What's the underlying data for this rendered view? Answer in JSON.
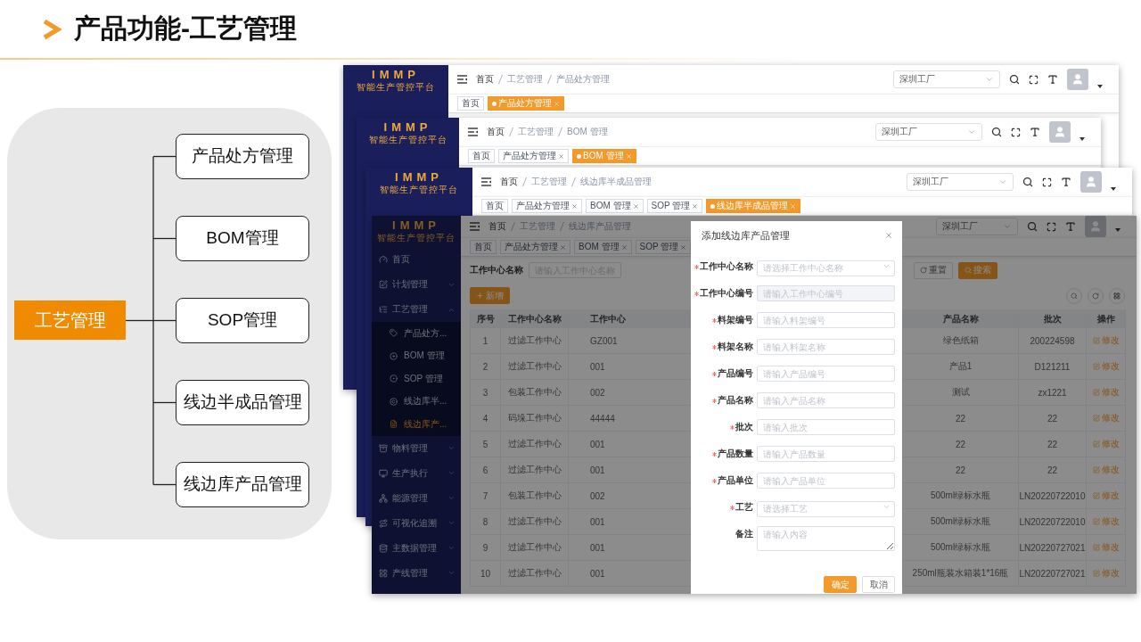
{
  "header": {
    "title": "产品功能-工艺管理"
  },
  "diagram": {
    "root": "工艺管理",
    "branches": [
      "产品处方管理",
      "BOM管理",
      "SOP管理",
      "线边半成品管理",
      "线边库产品管理"
    ]
  },
  "back_screens": [
    {
      "logo": "IMMP",
      "platform": "智能生产管控平台",
      "breadcrumb": [
        "首页",
        "工艺管理",
        "产品处方管理"
      ],
      "factory": "深圳工厂",
      "tags": [
        {
          "label": "首页",
          "selected": false,
          "closable": false
        },
        {
          "label": "产品处方管理",
          "selected": true,
          "closable": true
        }
      ]
    },
    {
      "logo": "IMMP",
      "platform": "智能生产管控平台",
      "breadcrumb": [
        "首页",
        "工艺管理",
        "BOM 管理"
      ],
      "factory": "深圳工厂",
      "tags": [
        {
          "label": "首页",
          "selected": false,
          "closable": false
        },
        {
          "label": "产品处方管理",
          "selected": false,
          "closable": true
        },
        {
          "label": "BOM 管理",
          "selected": true,
          "closable": true
        }
      ]
    },
    {
      "logo": "IMMP",
      "platform": "智能生产管控平台",
      "breadcrumb": [
        "首页",
        "工艺管理",
        "线边库半成品管理"
      ],
      "factory": "深圳工厂",
      "tags": [
        {
          "label": "首页",
          "selected": false,
          "closable": false
        },
        {
          "label": "产品处方管理",
          "selected": false,
          "closable": true
        },
        {
          "label": "BOM 管理",
          "selected": false,
          "closable": true
        },
        {
          "label": "SOP 管理",
          "selected": false,
          "closable": true
        },
        {
          "label": "线边库半成品管理",
          "selected": true,
          "closable": true
        }
      ]
    }
  ],
  "front_screen": {
    "logo": "IMMP",
    "platform": "智能生产管控平台",
    "breadcrumb": [
      "首页",
      "工艺管理",
      "线边库产品管理"
    ],
    "factory": "深圳工厂",
    "tags": [
      {
        "label": "首页",
        "selected": false,
        "closable": false
      },
      {
        "label": "产品处方管理",
        "selected": false,
        "closable": true
      },
      {
        "label": "BOM 管理",
        "selected": false,
        "closable": true
      },
      {
        "label": "SOP 管理",
        "selected": false,
        "closable": true
      }
    ],
    "sidebar": [
      {
        "label": "首页"
      },
      {
        "label": "计划管理",
        "expanded": false
      },
      {
        "label": "工艺管理",
        "expanded": true,
        "children": [
          {
            "label": "产品处方...",
            "selected": false
          },
          {
            "label": "BOM 管理",
            "selected": false
          },
          {
            "label": "SOP 管理",
            "selected": false
          },
          {
            "label": "线边库半...",
            "selected": false
          },
          {
            "label": "线边库产...",
            "selected": true
          }
        ]
      },
      {
        "label": "物料管理",
        "expanded": false
      },
      {
        "label": "生产执行",
        "expanded": false
      },
      {
        "label": "能源管理",
        "expanded": false
      },
      {
        "label": "可视化追溯",
        "expanded": false
      },
      {
        "label": "主数据管理",
        "expanded": false
      },
      {
        "label": "产线管理",
        "expanded": false
      }
    ],
    "filter": {
      "label": "工作中心名称",
      "placeholder": "请输入工作中心名称",
      "reset": "重置",
      "search": "搜索"
    },
    "add_button": "新增",
    "table": {
      "columns": [
        "序号",
        "工作中心名称",
        "工作中心",
        "产品名称",
        "批次",
        "操作"
      ],
      "rows": [
        [
          "1",
          "过滤工作中心",
          "GZ001",
          "绿色纸箱",
          "200224598",
          "修改"
        ],
        [
          "2",
          "过滤工作中心",
          "001",
          "产品1",
          "D121211",
          "修改"
        ],
        [
          "3",
          "包装工作中心",
          "002",
          "测试",
          "zx1221",
          "修改"
        ],
        [
          "4",
          "码垛工作中心",
          "44444",
          "22",
          "22",
          "修改"
        ],
        [
          "5",
          "过滤工作中心",
          "001",
          "22",
          "22",
          "修改"
        ],
        [
          "6",
          "过滤工作中心",
          "001",
          "22",
          "22",
          "修改"
        ],
        [
          "7",
          "包装工作中心",
          "002",
          "500ml绿标水瓶",
          "LN20220722010",
          "修改"
        ],
        [
          "8",
          "过滤工作中心",
          "001",
          "500ml绿标水瓶",
          "LN20220722010",
          "修改"
        ],
        [
          "9",
          "过滤工作中心",
          "001",
          "500ml绿标水瓶",
          "LN20220727021",
          "修改"
        ],
        [
          "10",
          "过滤工作中心",
          "001",
          "250ml瓶装水箱装1*16瓶",
          "LN20220727021",
          "修改"
        ]
      ]
    },
    "dialog": {
      "title": "添加线边库产品管理",
      "fields": [
        {
          "label": "工作中心名称",
          "kind": "select",
          "required": true,
          "disabled": false,
          "placeholder": "请选择工作中心名称"
        },
        {
          "label": "工作中心编号",
          "kind": "input",
          "required": true,
          "disabled": true,
          "placeholder": "请输入工作中心编号"
        },
        {
          "label": "料架编号",
          "kind": "input",
          "required": true,
          "disabled": false,
          "placeholder": "请输入料架编号"
        },
        {
          "label": "料架名称",
          "kind": "input",
          "required": true,
          "disabled": false,
          "placeholder": "请输入料架名称"
        },
        {
          "label": "产品编号",
          "kind": "input",
          "required": true,
          "disabled": false,
          "placeholder": "请输入产品编号"
        },
        {
          "label": "产品名称",
          "kind": "input",
          "required": true,
          "disabled": false,
          "placeholder": "请输入产品名称"
        },
        {
          "label": "批次",
          "kind": "input",
          "required": true,
          "disabled": false,
          "placeholder": "请输入批次"
        },
        {
          "label": "产品数量",
          "kind": "input",
          "required": true,
          "disabled": false,
          "placeholder": "请输入产品数量"
        },
        {
          "label": "产品单位",
          "kind": "input",
          "required": true,
          "disabled": false,
          "placeholder": "请输入产品单位"
        },
        {
          "label": "工艺",
          "kind": "select",
          "required": true,
          "disabled": false,
          "placeholder": "请选择工艺"
        },
        {
          "label": "备注",
          "kind": "textarea",
          "required": false,
          "disabled": false,
          "placeholder": "请输入内容"
        }
      ],
      "buttons": [
        {
          "label": "确定",
          "primary": true
        },
        {
          "label": "取消",
          "primary": false
        }
      ]
    }
  }
}
